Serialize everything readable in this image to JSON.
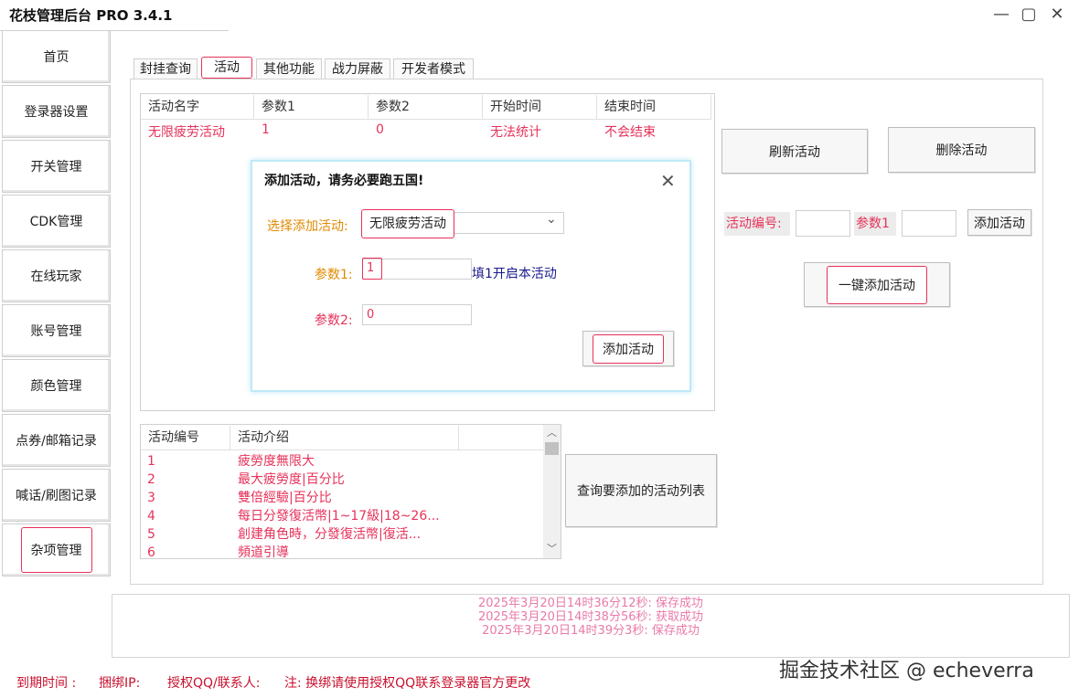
{
  "app": {
    "title": "花枝管理后台 PRO 3.4.1",
    "minimize": "—",
    "maximize": "▢",
    "close": "✕"
  },
  "sidebar": {
    "items": [
      {
        "label": "首页"
      },
      {
        "label": "登录器设置"
      },
      {
        "label": "开关管理"
      },
      {
        "label": "CDK管理"
      },
      {
        "label": "在线玩家"
      },
      {
        "label": "账号管理"
      },
      {
        "label": "颜色管理"
      },
      {
        "label": "点券/邮箱记录"
      },
      {
        "label": "喊话/刷图记录"
      },
      {
        "label": "杂项管理"
      }
    ]
  },
  "tabs": [
    {
      "label": "封挂查询"
    },
    {
      "label": "活动"
    },
    {
      "label": "其他功能"
    },
    {
      "label": "战力屏蔽"
    },
    {
      "label": "开发者模式"
    }
  ],
  "activity_table": {
    "headers": [
      "活动名字",
      "参数1",
      "参数2",
      "开始时间",
      "结束时间"
    ],
    "rows": [
      [
        "无限疲劳活动",
        "1",
        "0",
        "无法统计",
        "不会结束"
      ]
    ]
  },
  "right_panel": {
    "refresh_button": "刷新活动",
    "delete_button": "删除活动",
    "activity_id_label": "活动编号:",
    "param1_label": "参数1",
    "add_button": "添加活动",
    "one_click_button": "一键添加活动"
  },
  "dialog": {
    "title": "添加活动，请务必要跑五国!",
    "close": "✕",
    "select_label": "选择添加活动:",
    "select_value": "无限疲劳活动",
    "param1_label": "参数1:",
    "param1_value": "1",
    "param1_hint": "填1开启本活动",
    "param2_label": "参数2:",
    "param2_value": "0",
    "add_button": "添加活动"
  },
  "activity_list": {
    "headers": [
      "活动编号",
      "活动介绍"
    ],
    "rows": [
      {
        "id": "1",
        "desc": "疲勞度無限大"
      },
      {
        "id": "2",
        "desc": "最大疲勞度|百分比"
      },
      {
        "id": "3",
        "desc": "雙倍經驗|百分比"
      },
      {
        "id": "4",
        "desc": "每日分發復活幣|1~17級|18~26..."
      },
      {
        "id": "5",
        "desc": "創建角色時，分發復活幣|復活..."
      },
      {
        "id": "6",
        "desc": "頻道引導"
      }
    ],
    "query_button": "查询要添加的活动列表"
  },
  "log": [
    "2025年3月20日14时36分12秒: 保存成功",
    "2025年3月20日14时38分56秒: 获取成功",
    "2025年3月20日14时39分3秒: 保存成功"
  ],
  "footer": {
    "expire": "到期时间 :",
    "bind_ip": "捆绑IP:",
    "auth_qq": "授权QQ/联系人:",
    "note": "注: 换绑请使用授权QQ联系登录器官方更改"
  },
  "watermark": "掘金技术社区 @ echeverra",
  "colors": {
    "accent": "#e6325a",
    "hint_blue": "#1a1a8c",
    "label_orange": "#e08a00",
    "log_pink": "#e87aa8"
  }
}
